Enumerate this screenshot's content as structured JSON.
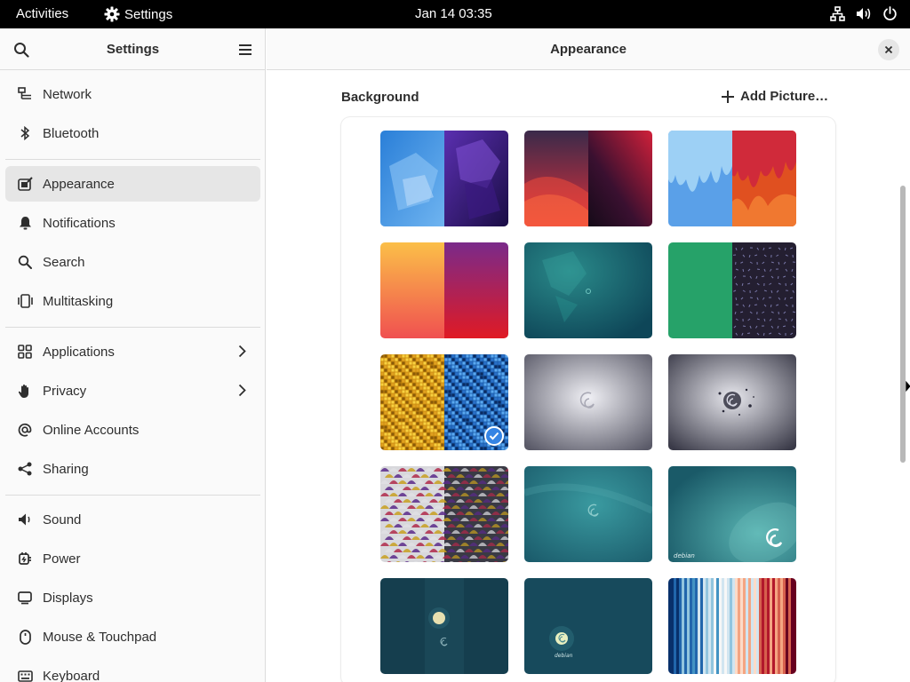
{
  "topbar": {
    "activities": "Activities",
    "app_name": "Settings",
    "clock": "Jan 14  03:35",
    "icons": [
      "network-icon",
      "volume-icon",
      "power-icon"
    ]
  },
  "sidebar": {
    "title": "Settings",
    "items": [
      {
        "label": "Network",
        "icon": "network-icon"
      },
      {
        "label": "Bluetooth",
        "icon": "bluetooth-icon"
      },
      {
        "label": "Appearance",
        "icon": "appearance-icon",
        "selected": true
      },
      {
        "label": "Notifications",
        "icon": "bell-icon"
      },
      {
        "label": "Search",
        "icon": "search-icon"
      },
      {
        "label": "Multitasking",
        "icon": "multitasking-icon"
      },
      {
        "label": "Applications",
        "icon": "apps-icon",
        "submenu": true
      },
      {
        "label": "Privacy",
        "icon": "hand-icon",
        "submenu": true
      },
      {
        "label": "Online Accounts",
        "icon": "at-icon"
      },
      {
        "label": "Sharing",
        "icon": "share-icon"
      },
      {
        "label": "Sound",
        "icon": "speaker-icon"
      },
      {
        "label": "Power",
        "icon": "power-plug-icon"
      },
      {
        "label": "Displays",
        "icon": "display-icon"
      },
      {
        "label": "Mouse & Touchpad",
        "icon": "mouse-icon"
      },
      {
        "label": "Keyboard",
        "icon": "keyboard-icon"
      }
    ]
  },
  "content": {
    "title": "Appearance",
    "section_title": "Background",
    "add_picture_label": "Add Picture…",
    "backgrounds": [
      {
        "name": "blobs",
        "selected": false
      },
      {
        "name": "fold",
        "selected": false
      },
      {
        "name": "drool",
        "selected": false
      },
      {
        "name": "amber-gradient",
        "selected": false
      },
      {
        "name": "emerald-teal",
        "selected": false
      },
      {
        "name": "pattern-dots",
        "selected": false
      },
      {
        "name": "pixels",
        "selected": true
      },
      {
        "name": "debian-swirl-gray",
        "selected": false
      },
      {
        "name": "debian-splash-gray",
        "selected": false
      },
      {
        "name": "tiles-mosaic",
        "selected": false
      },
      {
        "name": "debian-teal-swirl",
        "selected": false
      },
      {
        "name": "debian-teal-logo",
        "selected": false
      },
      {
        "name": "debian-moon-dark",
        "selected": false
      },
      {
        "name": "debian-moon-teal",
        "selected": false
      },
      {
        "name": "warming-stripes",
        "selected": false
      }
    ],
    "logo_text": "debian"
  },
  "colors": {
    "accent": "#3584e4",
    "sidebar_bg": "#fafafa",
    "selected_row": "#e6e6e6",
    "topbar_bg": "#000000"
  }
}
